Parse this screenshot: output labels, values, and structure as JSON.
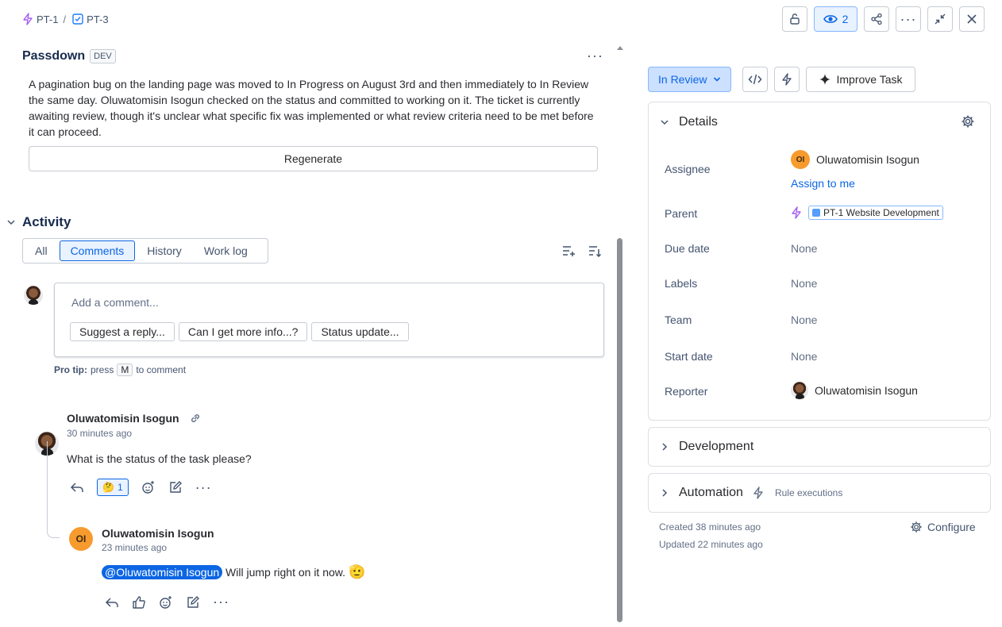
{
  "breadcrumb": {
    "parent": "PT-1",
    "separator": "/",
    "current": "PT-3"
  },
  "toolbar": {
    "watchers": "2"
  },
  "passdown": {
    "title": "Passdown",
    "tag": "DEV",
    "summary": "A pagination bug on the landing page was moved to In Progress on August 3rd and then immediately to In Review the same day. Oluwatomisin Isogun checked on the status and committed to working on it. The ticket is currently awaiting review, though it's unclear what specific fix was implemented or what review criteria need to be met before it can proceed.",
    "regenerate": "Regenerate"
  },
  "activity": {
    "title": "Activity",
    "tabs": [
      "All",
      "Comments",
      "History",
      "Work log"
    ],
    "active_tab": "Comments",
    "comment_placeholder": "Add a comment...",
    "suggestions": [
      "Suggest a reply...",
      "Can I get more info...?",
      "Status update..."
    ],
    "protip": {
      "label": "Pro tip:",
      "pre": "press",
      "key": "M",
      "post": "to comment"
    }
  },
  "comments": [
    {
      "author": "Oluwatomisin Isogun",
      "time": "30 minutes ago",
      "body": "What is the status of the task please?",
      "reaction": {
        "emoji": "🤔",
        "count": "1"
      }
    },
    {
      "author": "Oluwatomisin Isogun",
      "initials": "OI",
      "time": "23 minutes ago",
      "mention": "@Oluwatomisin Isogun",
      "body": " Will jump right on it now.",
      "emoji": "🫡"
    }
  ],
  "side": {
    "status": "In Review",
    "improve": "Improve Task",
    "details_title": "Details",
    "fields": {
      "assignee_label": "Assignee",
      "assignee_initials": "OI",
      "assignee": "Oluwatomisin Isogun",
      "assign_to_me": "Assign to me",
      "parent_label": "Parent",
      "parent": "PT-1 Website Development",
      "due_label": "Due date",
      "due": "None",
      "labels_label": "Labels",
      "labels": "None",
      "team_label": "Team",
      "team": "None",
      "start_label": "Start date",
      "start": "None",
      "reporter_label": "Reporter",
      "reporter": "Oluwatomisin Isogun"
    },
    "development": "Development",
    "automation": "Automation",
    "rule_executions": "Rule executions",
    "created": "Created 38 minutes ago",
    "updated": "Updated 22 minutes ago",
    "configure": "Configure"
  },
  "colors": {
    "accent": "#0c66e4",
    "accent_bg": "#e9f2ff",
    "status_bg": "#cce0ff",
    "avatar_orange": "#f79b2e"
  }
}
